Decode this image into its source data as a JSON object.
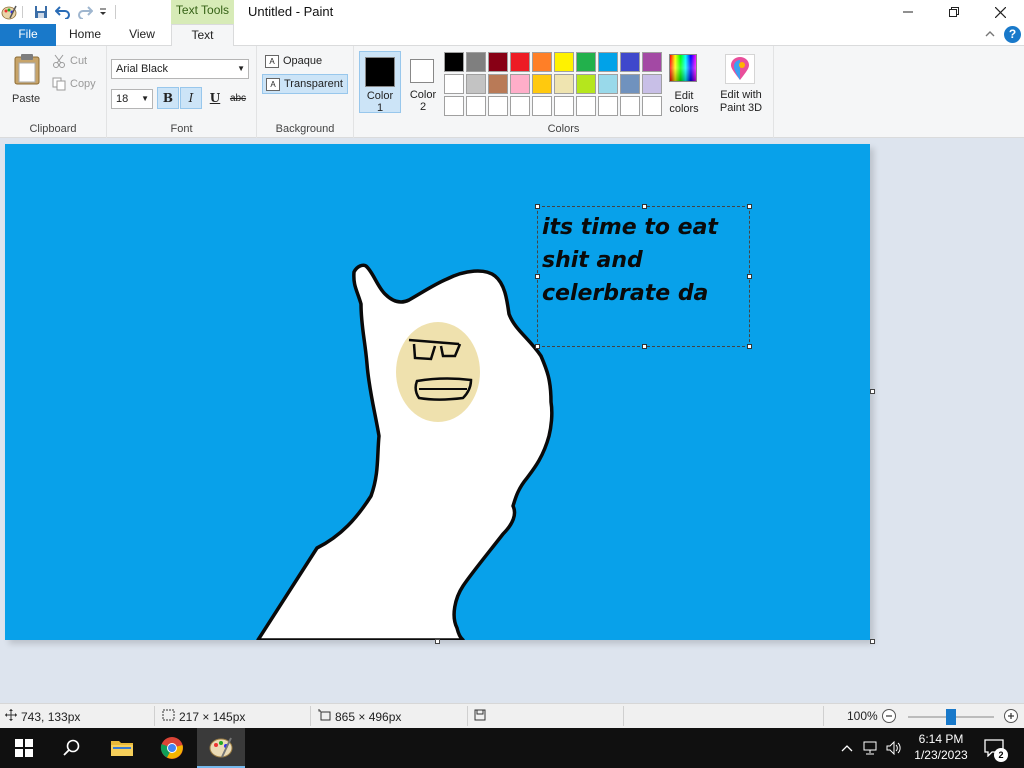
{
  "window": {
    "context_tab": "Text Tools",
    "title": "Untitled - Paint"
  },
  "tabs": {
    "file": "File",
    "home": "Home",
    "view": "View",
    "text": "Text"
  },
  "ribbon": {
    "clipboard": {
      "paste": "Paste",
      "cut": "Cut",
      "copy": "Copy",
      "label": "Clipboard"
    },
    "font": {
      "family": "Arial Black",
      "size": "18",
      "bold": "B",
      "italic": "I",
      "underline": "U",
      "strike": "abc",
      "label": "Font"
    },
    "background": {
      "opaque": "Opaque",
      "transparent": "Transparent",
      "label": "Background"
    },
    "colors": {
      "color1_line1": "Color",
      "color1_line2": "1",
      "color2_line1": "Color",
      "color2_line2": "2",
      "color1_value": "#000000",
      "color2_value": "#ffffff",
      "edit_line1": "Edit",
      "edit_line2": "colors",
      "label": "Colors",
      "palette": [
        "#000000",
        "#7f7f7f",
        "#880015",
        "#ed1c24",
        "#ff7f27",
        "#fff200",
        "#22b14c",
        "#00a2e8",
        "#3f48cc",
        "#a349a4",
        "#ffffff",
        "#c3c3c3",
        "#b97a57",
        "#ffaec9",
        "#ffc90e",
        "#efe4b0",
        "#b5e61d",
        "#99d9ea",
        "#7092be",
        "#c8bfe7",
        "#ffffff",
        "#ffffff",
        "#ffffff",
        "#ffffff",
        "#ffffff",
        "#ffffff",
        "#ffffff",
        "#ffffff",
        "#ffffff",
        "#ffffff"
      ]
    },
    "paint3d": {
      "line1": "Edit with",
      "line2": "Paint 3D"
    }
  },
  "canvas": {
    "background": "#08a1ea",
    "text": "its time to eat\nshit and\ncelerbrate da"
  },
  "status": {
    "cursor": "743, 133px",
    "selection": "217 × 145px",
    "image_size": "865 × 496px",
    "zoom": "100%",
    "zoom_level": 0.5
  },
  "taskbar": {
    "time": "6:14 PM",
    "date": "1/23/2023",
    "notifications": "2"
  }
}
